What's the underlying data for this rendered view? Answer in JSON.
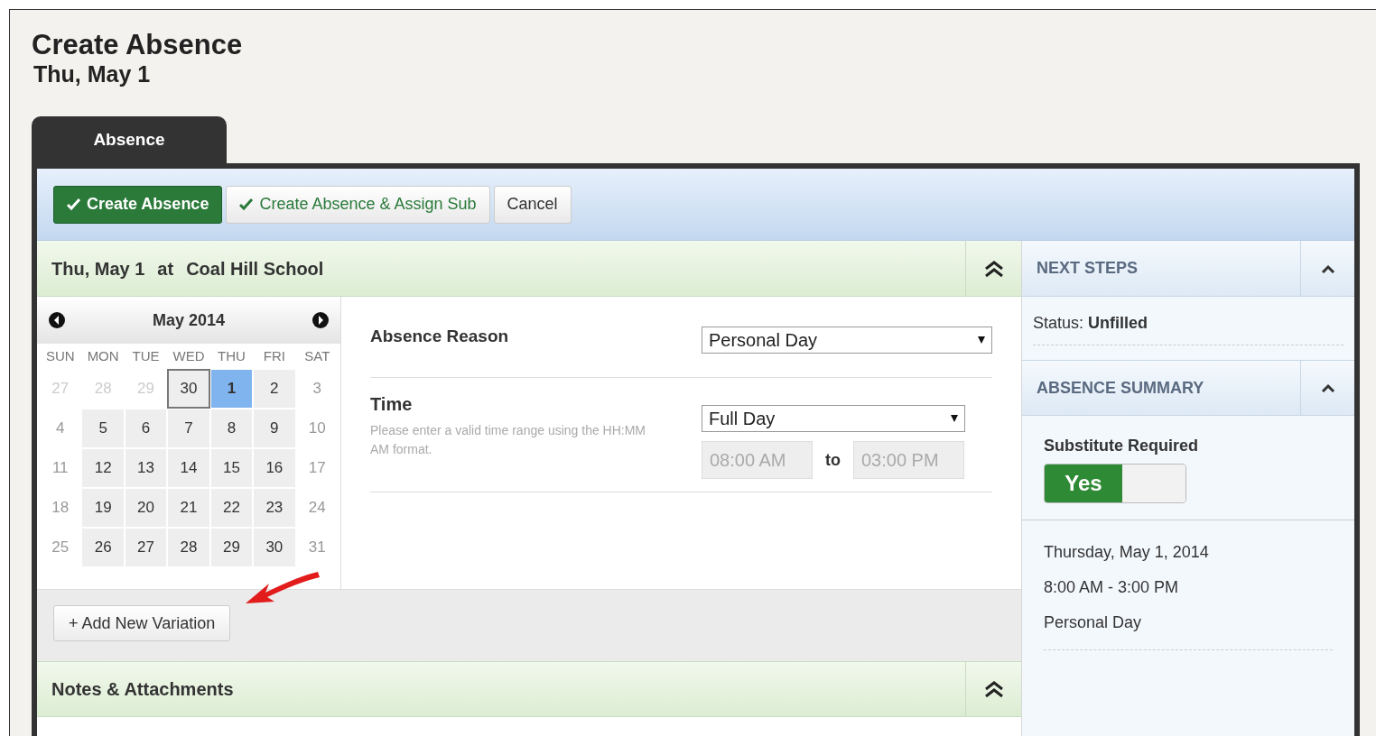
{
  "page": {
    "title": "Create Absence",
    "subtitle": "Thu, May 1"
  },
  "tabs": [
    {
      "label": "Absence",
      "selected": true
    }
  ],
  "toolbar": [
    {
      "label": "Create Absence",
      "kind": "primary",
      "check": true
    },
    {
      "label": "Create Absence & Assign Sub",
      "kind": "secondary",
      "check": true
    },
    {
      "label": "Cancel",
      "kind": "secondary",
      "check": false
    }
  ],
  "section": {
    "date": "Thu, May 1",
    "at": "at",
    "school": "Coal Hill School",
    "expanded": true
  },
  "calendar": {
    "month": "May 2014",
    "weekdays": [
      "SUN",
      "MON",
      "TUE",
      "WED",
      "THU",
      "FRI",
      "SAT"
    ],
    "weeks": [
      [
        {
          "label": "27",
          "kind": "other",
          "selected": false,
          "today": false
        },
        {
          "label": "28",
          "kind": "other",
          "selected": false,
          "today": false
        },
        {
          "label": "29",
          "kind": "other",
          "selected": false,
          "today": false
        },
        {
          "label": "30",
          "kind": "weekday",
          "selected": false,
          "today": true
        },
        {
          "label": "1",
          "kind": "weekday",
          "selected": true,
          "today": false
        },
        {
          "label": "2",
          "kind": "weekday",
          "selected": false,
          "today": false
        },
        {
          "label": "3",
          "kind": "weekend",
          "selected": false,
          "today": false
        }
      ],
      [
        {
          "label": "4",
          "kind": "weekend",
          "selected": false,
          "today": false
        },
        {
          "label": "5",
          "kind": "weekday",
          "selected": false,
          "today": false
        },
        {
          "label": "6",
          "kind": "weekday",
          "selected": false,
          "today": false
        },
        {
          "label": "7",
          "kind": "weekday",
          "selected": false,
          "today": false
        },
        {
          "label": "8",
          "kind": "weekday",
          "selected": false,
          "today": false
        },
        {
          "label": "9",
          "kind": "weekday",
          "selected": false,
          "today": false
        },
        {
          "label": "10",
          "kind": "weekend",
          "selected": false,
          "today": false
        }
      ],
      [
        {
          "label": "11",
          "kind": "weekend",
          "selected": false,
          "today": false
        },
        {
          "label": "12",
          "kind": "weekday",
          "selected": false,
          "today": false
        },
        {
          "label": "13",
          "kind": "weekday",
          "selected": false,
          "today": false
        },
        {
          "label": "14",
          "kind": "weekday",
          "selected": false,
          "today": false
        },
        {
          "label": "15",
          "kind": "weekday",
          "selected": false,
          "today": false
        },
        {
          "label": "16",
          "kind": "weekday",
          "selected": false,
          "today": false
        },
        {
          "label": "17",
          "kind": "weekend",
          "selected": false,
          "today": false
        }
      ],
      [
        {
          "label": "18",
          "kind": "weekend",
          "selected": false,
          "today": false
        },
        {
          "label": "19",
          "kind": "weekday",
          "selected": false,
          "today": false
        },
        {
          "label": "20",
          "kind": "weekday",
          "selected": false,
          "today": false
        },
        {
          "label": "21",
          "kind": "weekday",
          "selected": false,
          "today": false
        },
        {
          "label": "22",
          "kind": "weekday",
          "selected": false,
          "today": false
        },
        {
          "label": "23",
          "kind": "weekday",
          "selected": false,
          "today": false
        },
        {
          "label": "24",
          "kind": "weekend",
          "selected": false,
          "today": false
        }
      ],
      [
        {
          "label": "25",
          "kind": "weekend",
          "selected": false,
          "today": false
        },
        {
          "label": "26",
          "kind": "weekday",
          "selected": false,
          "today": false
        },
        {
          "label": "27",
          "kind": "weekday",
          "selected": false,
          "today": false
        },
        {
          "label": "28",
          "kind": "weekday",
          "selected": false,
          "today": false
        },
        {
          "label": "29",
          "kind": "weekday",
          "selected": false,
          "today": false
        },
        {
          "label": "30",
          "kind": "weekday",
          "selected": false,
          "today": false
        },
        {
          "label": "31",
          "kind": "weekend",
          "selected": false,
          "today": false
        }
      ]
    ]
  },
  "form": {
    "reason_label": "Absence Reason",
    "reason_value": "Personal Day",
    "time_label": "Time",
    "time_help": "Please enter a valid time range using the HH:MM AM format.",
    "duration_value": "Full Day",
    "start_time": "08:00 AM",
    "to": "to",
    "end_time": "03:00 PM"
  },
  "add_variation": "+ Add New Variation",
  "notes": {
    "title": "Notes & Attachments",
    "expanded": true
  },
  "next_steps": {
    "title": "NEXT STEPS",
    "expanded": true,
    "status_label": "Status:",
    "status_value": "Unfilled"
  },
  "summary": {
    "title": "ABSENCE SUMMARY",
    "expanded": true,
    "sub_label": "Substitute Required",
    "sub_on": true,
    "sub_text": "Yes",
    "lines": [
      "Thursday, May 1, 2014",
      "8:00 AM - 3:00 PM",
      "Personal Day"
    ]
  }
}
